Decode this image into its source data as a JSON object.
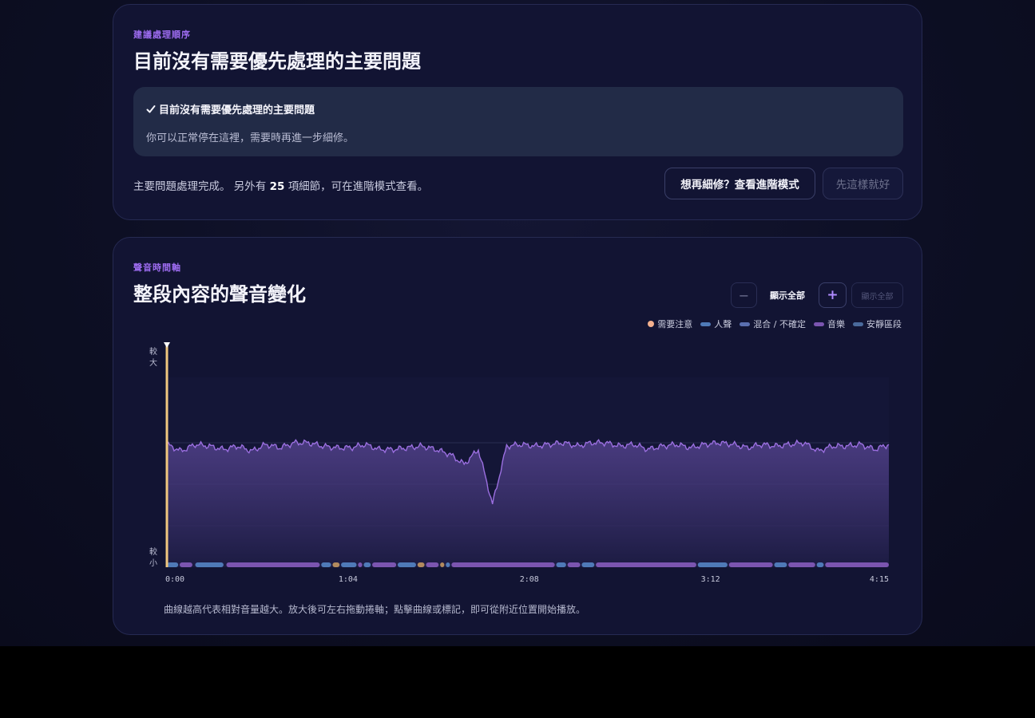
{
  "plan": {
    "eyebrow": "建議處理順序",
    "title": "目前沒有需要優先處理的主要問題",
    "notice_title": "目前沒有需要優先處理的主要問題",
    "notice_body": "你可以正常停在這裡，需要時再進一步細修。",
    "summary_prefix": "主要問題處理完成。 另外有",
    "summary_count": "25",
    "summary_suffix": "項細節，可在進階模式查看。",
    "advanced_button": "想再細修？查看進階模式",
    "done_button": "先這樣就好"
  },
  "timeline": {
    "eyebrow": "聲音時間軸",
    "title": "整段內容的聲音變化",
    "zoom_out": "−",
    "zoom_label": "顯示全部",
    "zoom_in": "+",
    "show_all": "顯示全部",
    "legend": [
      {
        "label": "需要注意",
        "kind": "dot",
        "color": "#f3b08e"
      },
      {
        "label": "人聲",
        "kind": "pill",
        "color": "#4f7ab8"
      },
      {
        "label": "混合 / 不確定",
        "kind": "pill",
        "color": "#5a6fb0"
      },
      {
        "label": "音樂",
        "kind": "pill",
        "color": "#7b55b0"
      },
      {
        "label": "安靜區段",
        "kind": "pill",
        "color": "#4a6a9c"
      }
    ],
    "caption": "曲線越高代表相對音量越大。放大後可左右拖動捲軸；點擊曲線或標記，即可從附近位置開始播放。"
  },
  "chart_data": {
    "type": "area",
    "ylabel_top": "較大",
    "ylabel_bottom": "較小",
    "x_ticks": [
      "0:00",
      "1:04",
      "2:08",
      "3:12",
      "4:15"
    ],
    "x_tick_seconds": [
      0,
      64,
      128,
      192,
      255
    ],
    "xlim": [
      0,
      255
    ],
    "ylim": [
      0,
      1
    ],
    "playhead_seconds": 0,
    "line_color": "#9b6fe0",
    "accent_color": "#f0c77f",
    "envelope": {
      "x_step_seconds": 5,
      "values": [
        0.74,
        0.7,
        0.74,
        0.73,
        0.71,
        0.73,
        0.7,
        0.74,
        0.72,
        0.75,
        0.75,
        0.73,
        0.72,
        0.72,
        0.74,
        0.71,
        0.71,
        0.72,
        0.73,
        0.71,
        0.68,
        0.62,
        0.71,
        0.38,
        0.73,
        0.74,
        0.73,
        0.74,
        0.75,
        0.73,
        0.75,
        0.75,
        0.73,
        0.74,
        0.71,
        0.73,
        0.74,
        0.72,
        0.74,
        0.75,
        0.74,
        0.72,
        0.74,
        0.73,
        0.74,
        0.75,
        0.7,
        0.73,
        0.73,
        0.74,
        0.71,
        0.74,
        0.73
      ]
    },
    "segments": [
      {
        "start": 0,
        "end": 4,
        "class": "voice"
      },
      {
        "start": 4.5,
        "end": 9,
        "class": "music"
      },
      {
        "start": 10,
        "end": 20,
        "class": "voice"
      },
      {
        "start": 21,
        "end": 54,
        "class": "music"
      },
      {
        "start": 54.5,
        "end": 58,
        "class": "voice"
      },
      {
        "start": 58.5,
        "end": 61,
        "class": "attention"
      },
      {
        "start": 61.5,
        "end": 67,
        "class": "voice"
      },
      {
        "start": 67.5,
        "end": 69,
        "class": "music"
      },
      {
        "start": 69.5,
        "end": 72,
        "class": "voice"
      },
      {
        "start": 72.5,
        "end": 81,
        "class": "music"
      },
      {
        "start": 81.5,
        "end": 88,
        "class": "voice"
      },
      {
        "start": 88.5,
        "end": 91,
        "class": "attention"
      },
      {
        "start": 91.5,
        "end": 96,
        "class": "music"
      },
      {
        "start": 96.5,
        "end": 98,
        "class": "attention"
      },
      {
        "start": 98.5,
        "end": 100,
        "class": "voice"
      },
      {
        "start": 100.5,
        "end": 137,
        "class": "music"
      },
      {
        "start": 137.5,
        "end": 141,
        "class": "voice"
      },
      {
        "start": 141.5,
        "end": 146,
        "class": "music"
      },
      {
        "start": 146.5,
        "end": 151,
        "class": "voice"
      },
      {
        "start": 151.5,
        "end": 187,
        "class": "music"
      },
      {
        "start": 187.5,
        "end": 198,
        "class": "voice"
      },
      {
        "start": 198.5,
        "end": 214,
        "class": "music"
      },
      {
        "start": 214.5,
        "end": 219,
        "class": "voice"
      },
      {
        "start": 219.5,
        "end": 229,
        "class": "music"
      },
      {
        "start": 229.5,
        "end": 232,
        "class": "voice"
      },
      {
        "start": 232.5,
        "end": 255,
        "class": "music"
      }
    ],
    "segment_colors": {
      "voice": "#4f7ab8",
      "music": "#7b55b0",
      "attention": "#b28a5e"
    }
  }
}
